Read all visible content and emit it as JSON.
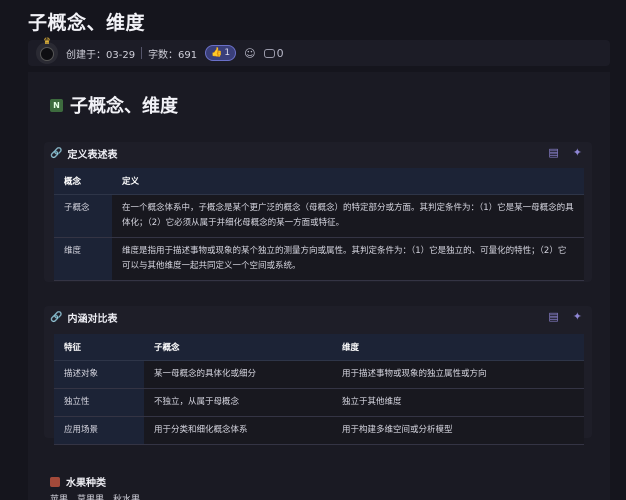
{
  "doc": {
    "title": "子概念、维度",
    "created": "创建于：03-29",
    "word_count": "字数：691",
    "likes": "1",
    "comments": "0"
  },
  "heading": {
    "badge": "N",
    "text": "子概念、维度"
  },
  "def_table": {
    "title": "定义表述表",
    "headers": [
      "概念",
      "定义"
    ],
    "rows": [
      [
        "子概念",
        "在一个概念体系中，子概念是某个更广泛的概念（母概念）的特定部分或方面。其判定条件为：（1）它是某一母概念的具体化；（2）它必须从属于并细化母概念的某一方面或特征。"
      ],
      [
        "维度",
        "维度是指用于描述事物或现象的某个独立的测量方向或属性。其判定条件为：（1）它是独立的、可量化的特性；（2）它可以与其他维度一起共同定义一个空间或系统。"
      ]
    ]
  },
  "cmp_table": {
    "title": "内涵对比表",
    "headers": [
      "特征",
      "子概念",
      "维度"
    ],
    "rows": [
      [
        "描述对象",
        "某一母概念的具体化或细分",
        "用于描述事物或现象的独立属性或方向"
      ],
      [
        "独立性",
        "不独立，从属于母概念",
        "独立于其他维度"
      ],
      [
        "应用场景",
        "用于分类和细化概念体系",
        "用于构建多维空间或分析模型"
      ]
    ]
  },
  "fruit": {
    "title": "水果种类",
    "partial_text": "苹果、草果果、秋水果"
  }
}
